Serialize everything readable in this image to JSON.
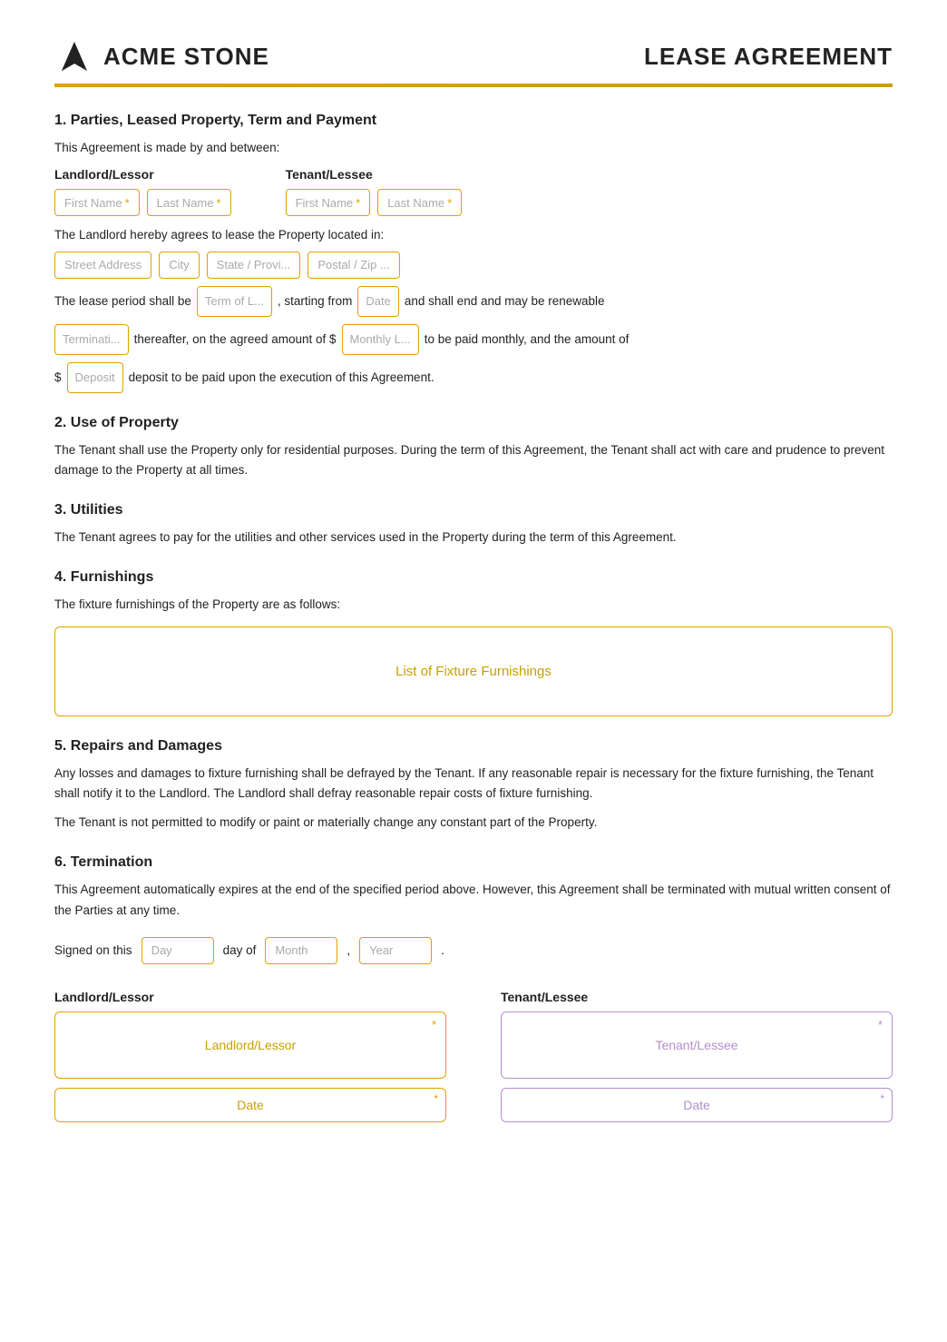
{
  "header": {
    "logo_text": "ACME STONE",
    "doc_title": "LEASE AGREEMENT"
  },
  "section1": {
    "title": "1. Parties, Leased Property, Term and Payment",
    "intro": "This Agreement is made by and between:",
    "landlord_label": "Landlord/Lessor",
    "tenant_label": "Tenant/Lessee",
    "landlord_first": "First Name",
    "landlord_last": "Last Name",
    "tenant_first": "First Name",
    "tenant_last": "Last Name",
    "property_text": "The Landlord hereby agrees to lease the Property located in:",
    "street": "Street Address",
    "city": "City",
    "state": "State / Provi...",
    "postal": "Postal / Zip ...",
    "lease_text1": "The lease period shall be",
    "term_field": "Term of L...",
    "lease_text2": ", starting from",
    "date_field": "Date",
    "lease_text3": "and shall end and may be renewable",
    "termination_field": "Terminati...",
    "lease_text4": "thereafter, on the agreed amount of $",
    "monthly_field": "Monthly L...",
    "lease_text5": "to be paid monthly, and the amount of",
    "deposit_prefix": "$",
    "deposit_field": "Deposit",
    "lease_text6": "deposit to be paid upon the execution of this Agreement."
  },
  "section2": {
    "title": "2. Use of Property",
    "body": "The Tenant shall use the Property only for residential purposes. During the term of this Agreement, the Tenant shall act with care and prudence to prevent damage to the Property at all times."
  },
  "section3": {
    "title": "3. Utilities",
    "body": "The Tenant agrees to pay for the utilities and other services used in the Property during the term of this Agreement."
  },
  "section4": {
    "title": "4. Furnishings",
    "intro": "The fixture furnishings of the Property are as follows:",
    "furnishings_placeholder": "List of Fixture Furnishings"
  },
  "section5": {
    "title": "5. Repairs and Damages",
    "body1": "Any losses and damages to fixture furnishing shall be defrayed by the Tenant. If any reasonable repair is necessary for the fixture furnishing, the Tenant shall notify it to the Landlord. The Landlord shall defray reasonable repair costs of fixture furnishing.",
    "body2": "The Tenant is not permitted to modify or paint or materially change any constant part of the Property."
  },
  "section6": {
    "title": "6. Termination",
    "body": "This Agreement automatically expires at the end of the specified period above. However, this Agreement shall be terminated with mutual written consent of the Parties at any time.",
    "signed_text1": "Signed on this",
    "day_field": "Day",
    "signed_text2": "day of",
    "month_field": "Month",
    "year_field": "Year",
    "landlord_label": "Landlord/Lessor",
    "tenant_label": "Tenant/Lessee",
    "landlord_sig": "Landlord/Lessor",
    "tenant_sig": "Tenant/Lessee",
    "date_label": "Date",
    "date_label2": "Date"
  }
}
